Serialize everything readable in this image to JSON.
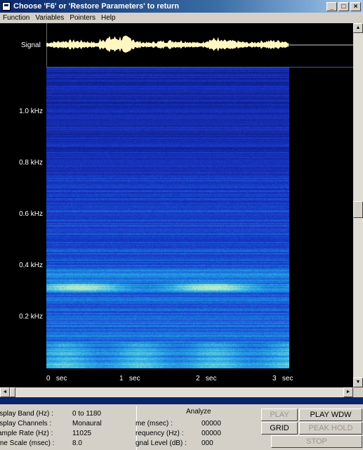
{
  "window": {
    "title": "Choose 'F6' or 'Restore Parameters' to return",
    "controls": [
      "minimize",
      "maximize",
      "close"
    ]
  },
  "menu": [
    "Function",
    "Variables",
    "Pointers",
    "Help"
  ],
  "display": {
    "signal_label": "Signal",
    "y_ticks": [
      "1.0 kHz",
      "0.8 kHz",
      "0.6 kHz",
      "0.4 kHz",
      "0.2 kHz"
    ],
    "x_ticks": [
      {
        "value": "0",
        "unit": "sec"
      },
      {
        "value": "1",
        "unit": "sec"
      },
      {
        "value": "2",
        "unit": "sec"
      },
      {
        "value": "3",
        "unit": "sec"
      }
    ],
    "colors": {
      "background": "#000000",
      "spectrogram_low": "#1a2fb8",
      "spectrogram_mid": "#1f8ae0",
      "spectrogram_high": "#6fe6e0",
      "waveform": "#fff6c0"
    }
  },
  "info": {
    "rows": [
      {
        "label": "isplay Band (Hz) :",
        "value": "0 to 1180"
      },
      {
        "label": "isplay Channels :",
        "value": "Monaural"
      },
      {
        "label": "ample Rate (Hz) :",
        "value": "11025"
      },
      {
        "label": "me Scale (msec) :",
        "value": "8.0"
      }
    ]
  },
  "analyze": {
    "title": "Analyze",
    "rows": [
      {
        "label": "me (msec) :",
        "value": "00000"
      },
      {
        "label": "requency (Hz) :",
        "value": "00000"
      },
      {
        "label": "gnal Level (dB) :",
        "value": "000"
      }
    ]
  },
  "buttons": {
    "play": "PLAY",
    "play_wdw": "PLAY WDW",
    "grid": "GRID",
    "peak_hold": "PEAK HOLD",
    "stop": "STOP"
  }
}
